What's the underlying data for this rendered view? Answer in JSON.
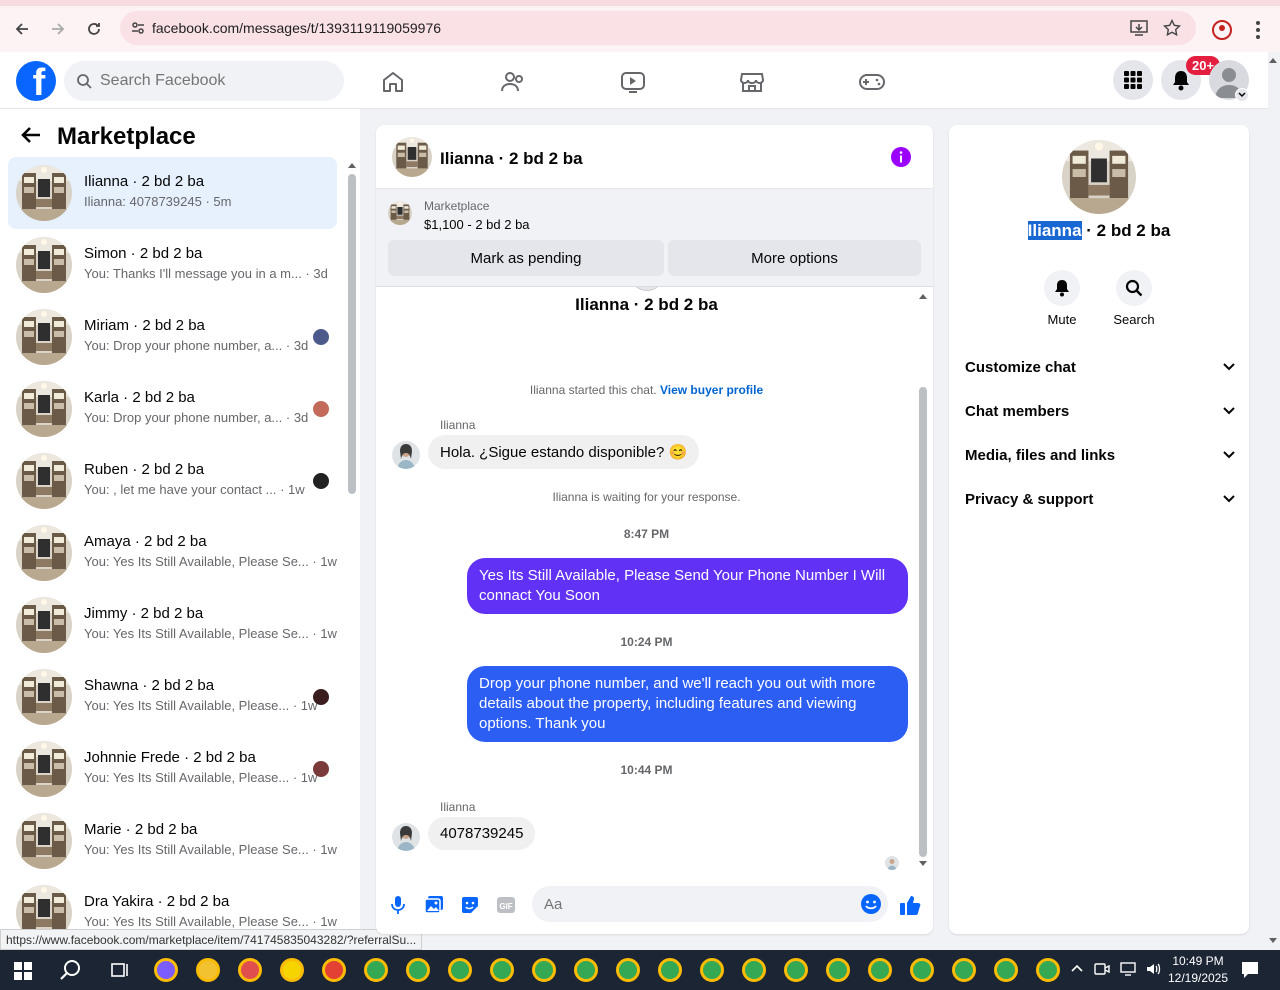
{
  "browser": {
    "url": "facebook.com/messages/t/1393119119059976",
    "status_url": "https://www.facebook.com/marketplace/item/741745835043282/?referralSu..."
  },
  "header": {
    "search_placeholder": "Search Facebook",
    "notification_badge": "20+"
  },
  "sidebar": {
    "title": "Marketplace",
    "conversations": [
      {
        "name": "Ilianna · 2 bd 2 ba",
        "preview": "Ilianna: 4078739245 · 5m",
        "active": true
      },
      {
        "name": "Simon · 2 bd 2 ba",
        "preview": "You: Thanks I'll message you in a m... · 3d"
      },
      {
        "name": "Miriam · 2 bd 2 ba",
        "preview": "You: Drop your phone number, a... · 3d"
      },
      {
        "name": "Karla · 2 bd 2 ba",
        "preview": "You: Drop your phone number, a... · 3d"
      },
      {
        "name": "Ruben · 2 bd 2 ba",
        "preview": "You: , let me have your contact ... · 1w"
      },
      {
        "name": "Amaya · 2 bd 2 ba",
        "preview": "You: Yes Its Still Available, Please Se... · 1w"
      },
      {
        "name": "Jimmy · 2 bd 2 ba",
        "preview": "You: Yes Its Still Available, Please Se... · 1w"
      },
      {
        "name": "Shawna · 2 bd 2 ba",
        "preview": "You: Yes Its Still Available, Please... · 1w"
      },
      {
        "name": "Johnnie Frede · 2 bd 2 ba",
        "preview": "You: Yes Its Still Available, Please... · 1w"
      },
      {
        "name": "Marie · 2 bd 2 ba",
        "preview": "You: Yes Its Still Available, Please Se... · 1w"
      },
      {
        "name": "Dra Yakira · 2 bd 2 ba",
        "preview": "You: Yes Its Still Available, Please Se... · 1w"
      }
    ]
  },
  "chat": {
    "title": "Ilianna · 2 bd 2 ba",
    "listing_type": "Marketplace",
    "listing_price": "$1,100 - 2 bd 2 ba",
    "btn_pending": "Mark as pending",
    "btn_more": "More options",
    "thread_title": "Ilianna · 2 bd 2 ba",
    "started_text": "Ilianna started this chat.",
    "buyer_profile_link": "View buyer profile",
    "sender_name": "Ilianna",
    "msg1": "Hola. ¿Sigue estando disponible? 😊",
    "waiting": "Ilianna is waiting for your response.",
    "time1": "8:47 PM",
    "out1": "Yes Its Still Available, Please Send Your Phone Number I Will connact You Soon",
    "time2": "10:24 PM",
    "out2": "Drop your phone number, and we'll reach you out with more details about the property, including features and viewing options.  Thank you",
    "time3": "10:44 PM",
    "msg2": "4078739245",
    "composer_placeholder": "Aa"
  },
  "details": {
    "name_highlight": "Ilianna",
    "name_rest": " · 2 bd 2 ba",
    "mute": "Mute",
    "search": "Search",
    "sections": [
      "Customize chat",
      "Chat members",
      "Media, files and links",
      "Privacy & support"
    ]
  },
  "taskbar": {
    "time": "10:49 PM",
    "date": "12/19/2025"
  },
  "colors": {
    "fb_blue": "#0866ff",
    "bubble_purple": "#6132f5",
    "bubble_blue": "#2d5ef3",
    "active_conv": "#e7f1fe"
  }
}
